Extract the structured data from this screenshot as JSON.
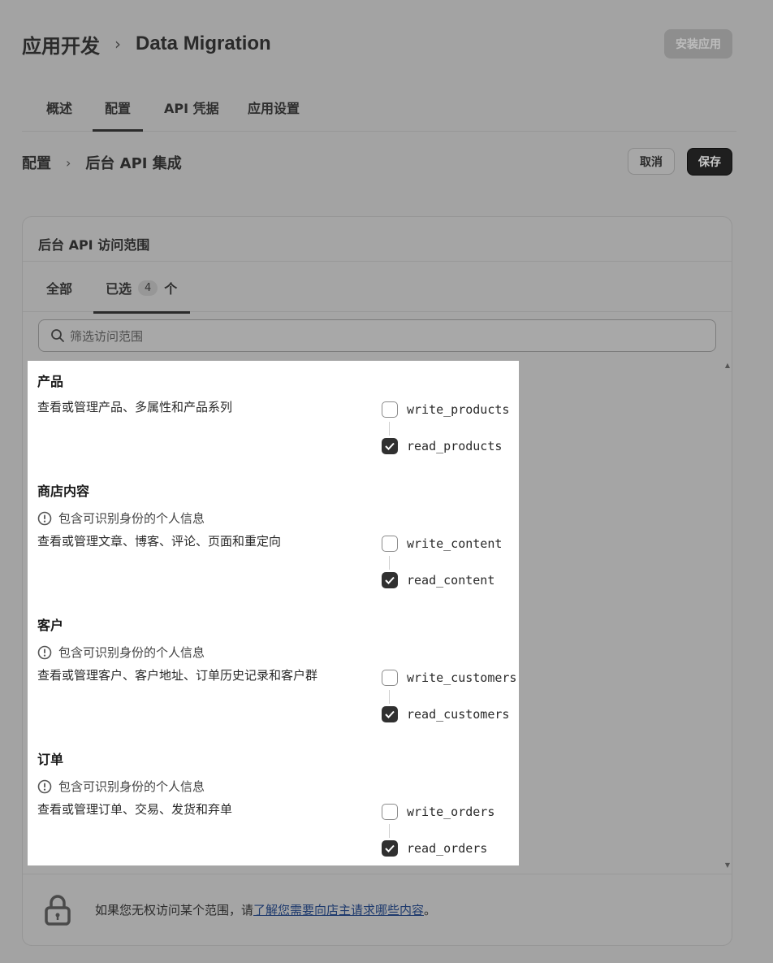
{
  "header": {
    "app": "应用开发",
    "title": "Data Migration",
    "install_label": "安装应用"
  },
  "top_tabs": [
    {
      "label": "概述"
    },
    {
      "label": "配置"
    },
    {
      "label": "API 凭据"
    },
    {
      "label": "应用设置"
    }
  ],
  "top_tabs_active": "配置",
  "sub_header": {
    "crumb": "配置",
    "title": "后台 API 集成",
    "cancel_label": "取消",
    "save_label": "保存"
  },
  "card": {
    "title": "后台 API 访问范围",
    "tabs": {
      "all_label": "全部",
      "selected_prefix": "已选",
      "selected_count": "4",
      "selected_suffix": "个"
    },
    "search_placeholder": "筛选访问范围",
    "groups": [
      {
        "title": "产品",
        "warning": "",
        "desc": "查看或管理产品、多属性和产品系列",
        "options": [
          {
            "label": "write_products",
            "checked": false
          },
          {
            "label": "read_products",
            "checked": true
          }
        ]
      },
      {
        "title": "商店内容",
        "warning": "包含可识别身份的个人信息",
        "desc": "查看或管理文章、博客、评论、页面和重定向",
        "options": [
          {
            "label": "write_content",
            "checked": false
          },
          {
            "label": "read_content",
            "checked": true
          }
        ]
      },
      {
        "title": "客户",
        "warning": "包含可识别身份的个人信息",
        "desc": "查看或管理客户、客户地址、订单历史记录和客户群",
        "options": [
          {
            "label": "write_customers",
            "checked": false
          },
          {
            "label": "read_customers",
            "checked": true
          }
        ]
      },
      {
        "title": "订单",
        "warning": "包含可识别身份的个人信息",
        "desc": "查看或管理订单、交易、发货和弃单",
        "options": [
          {
            "label": "write_orders",
            "checked": false
          },
          {
            "label": "read_orders",
            "checked": true
          }
        ]
      }
    ],
    "footer": {
      "text_before": "如果您无权访问某个范围，请",
      "link": "了解您需要向店主请求哪些内容",
      "text_after": "。"
    }
  },
  "icons": {
    "search": "search-icon",
    "warning": "alert-circle-icon",
    "lock": "lock-icon",
    "chevron": "chevron-right-icon"
  }
}
